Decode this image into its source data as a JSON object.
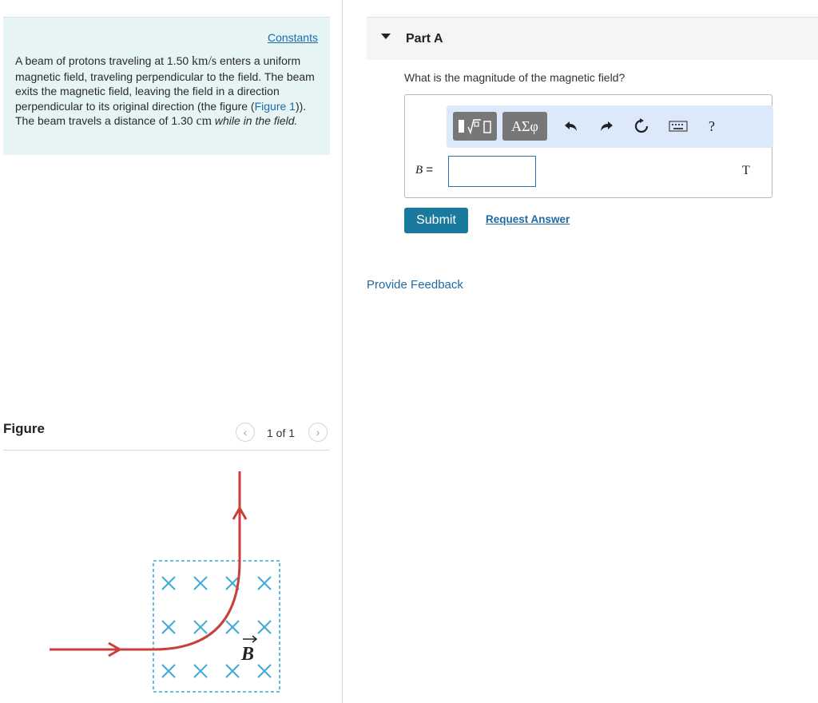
{
  "problem": {
    "constants_link": "Constants",
    "text_1": "A beam of protons traveling at 1.50 ",
    "speed_unit": "km/s",
    "text_2": " enters a uniform magnetic field, traveling perpendicular to the field. The beam exits the magnetic field, leaving the field in a direction perpendicular to its original direction (the figure (",
    "figure_link": "Figure 1",
    "text_3": ")). The beam travels a distance of 1.30 ",
    "distance_unit": "cm",
    "text_4": " while in the field."
  },
  "figure": {
    "title": "Figure",
    "pager": "1 of 1",
    "field_label": "B",
    "colors": {
      "beam": "#c9403a",
      "field_box": "#3fa9d8",
      "field_x": "#3fa9d8"
    }
  },
  "part": {
    "title": "Part A",
    "question": "What is the magnitude of the magnetic field?",
    "toolbar": {
      "templates_icon": "templates-icon",
      "greek_label": "ΑΣφ",
      "undo_icon": "undo-icon",
      "redo_icon": "redo-icon",
      "reset_icon": "reset-icon",
      "keyboard_icon": "keyboard-icon",
      "help_label": "?"
    },
    "variable": "B",
    "equals": " =",
    "answer_value": "",
    "unit": "T",
    "submit_label": "Submit",
    "request_answer_label": "Request Answer"
  },
  "feedback_label": "Provide Feedback",
  "colors": {
    "accent": "#1a7a9e",
    "link": "#1f6aa5",
    "panel_bg": "#e7f4f6",
    "toolbar_bg": "#dbe9fb"
  }
}
